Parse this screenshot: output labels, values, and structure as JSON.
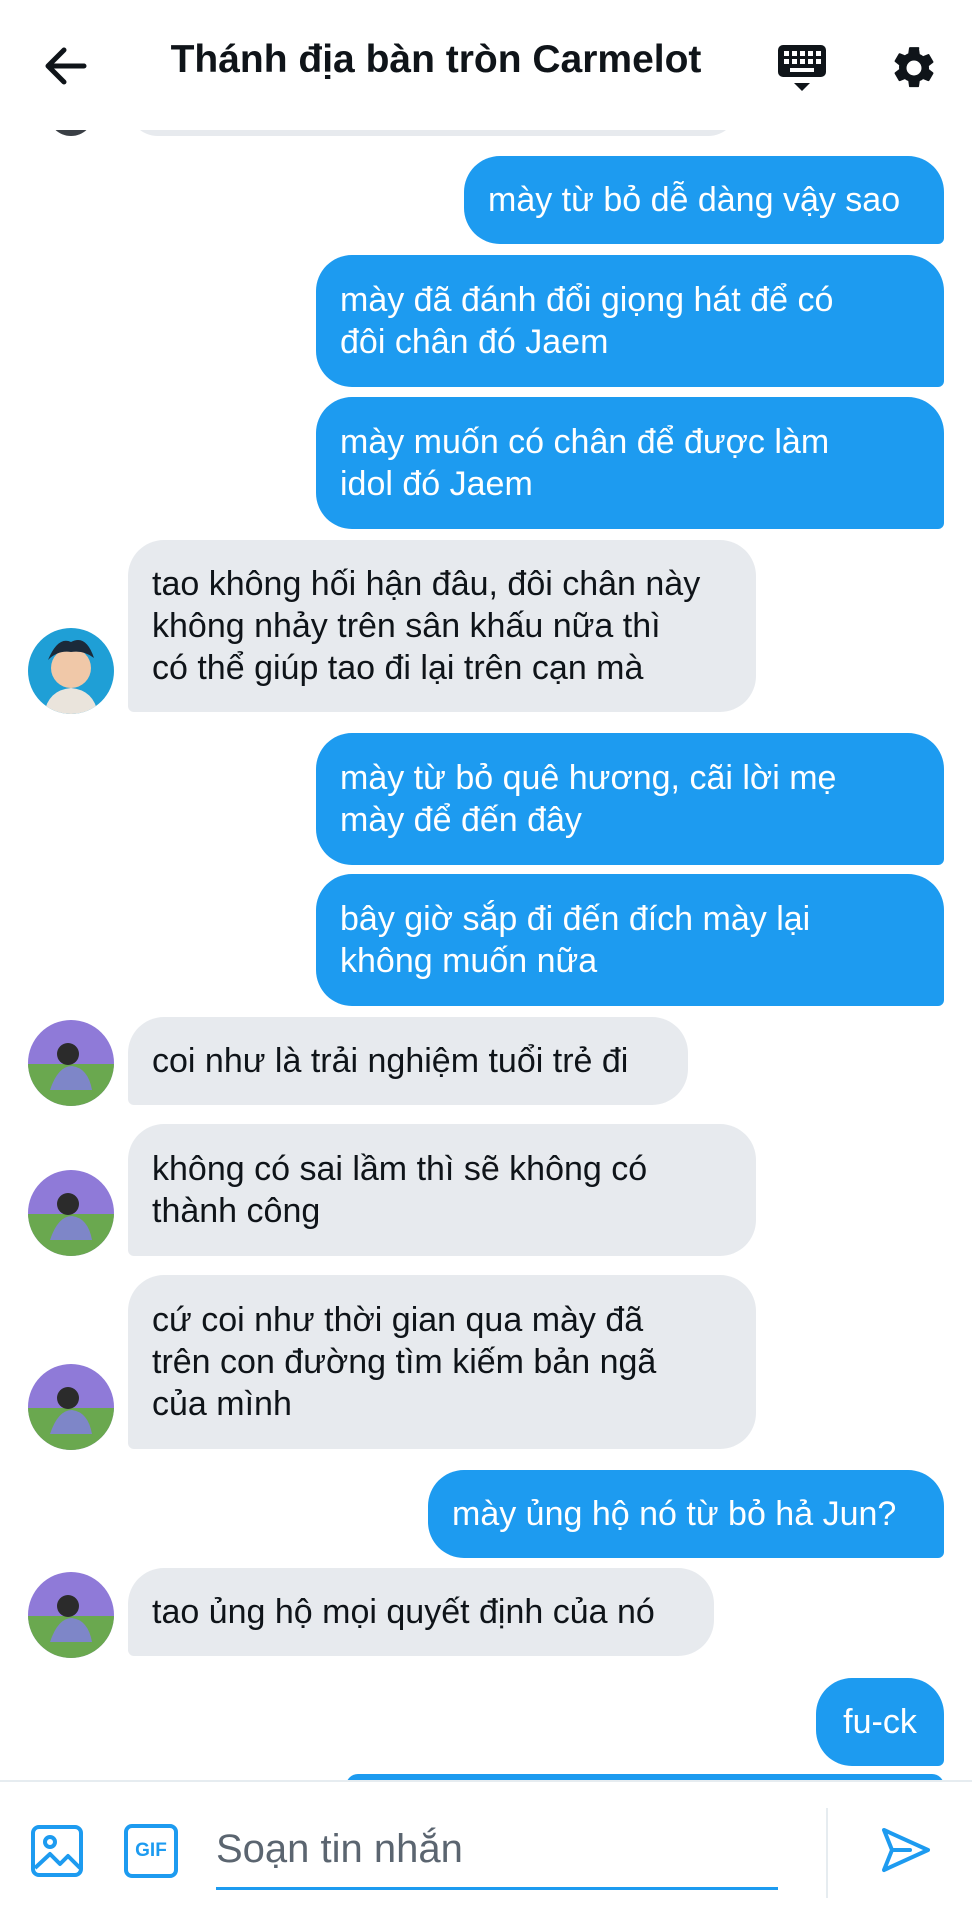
{
  "header": {
    "title": "Thánh địa bàn tròn Carmelot"
  },
  "messages": [
    {
      "dir": "out",
      "lines": [
        "mày từ bỏ dễ dàng vậy sao"
      ]
    },
    {
      "dir": "out",
      "lines": [
        "mày đã đánh đổi giọng hát để có",
        "đôi chân đó Jaem"
      ]
    },
    {
      "dir": "out",
      "lines": [
        "mày muốn có chân để được làm",
        "idol đó Jaem"
      ]
    },
    {
      "dir": "in",
      "lines": [
        "tao không hối hận đâu, đôi chân này",
        "không nhảy trên sân khấu nữa thì",
        "có thể giúp tao đi lại trên cạn mà"
      ]
    },
    {
      "dir": "out",
      "lines": [
        "mày từ bỏ quê hương, cãi lời mẹ",
        "mày để đến đây"
      ]
    },
    {
      "dir": "out",
      "lines": [
        "bây giờ sắp đi đến đích mày lại",
        "không muốn nữa"
      ]
    },
    {
      "dir": "in",
      "lines": [
        "coi như là trải nghiệm tuổi trẻ đi"
      ]
    },
    {
      "dir": "in",
      "lines": [
        "không có sai lầm thì sẽ không có",
        "thành công"
      ]
    },
    {
      "dir": "in",
      "lines": [
        "cứ coi như thời gian qua mày đã",
        "trên con đường tìm kiếm bản ngã",
        "của mình"
      ]
    },
    {
      "dir": "out",
      "lines": [
        "mày ủng hộ nó từ bỏ hả Jun?"
      ]
    },
    {
      "dir": "in",
      "lines": [
        "tao ủng hộ mọi quyết định của nó"
      ]
    },
    {
      "dir": "out",
      "lines": [
        "fu-ck"
      ]
    }
  ],
  "composer": {
    "placeholder": "Soạn tin nhắn",
    "gif_label": "GIF"
  },
  "colors": {
    "outgoing_bubble": "#1d9bf0",
    "incoming_bubble": "#e7eaee",
    "accent": "#1d9bf0"
  },
  "icons": [
    "arrow-left-icon",
    "keyboard-icon",
    "gear-icon",
    "image-icon",
    "gif-icon",
    "send-icon"
  ]
}
